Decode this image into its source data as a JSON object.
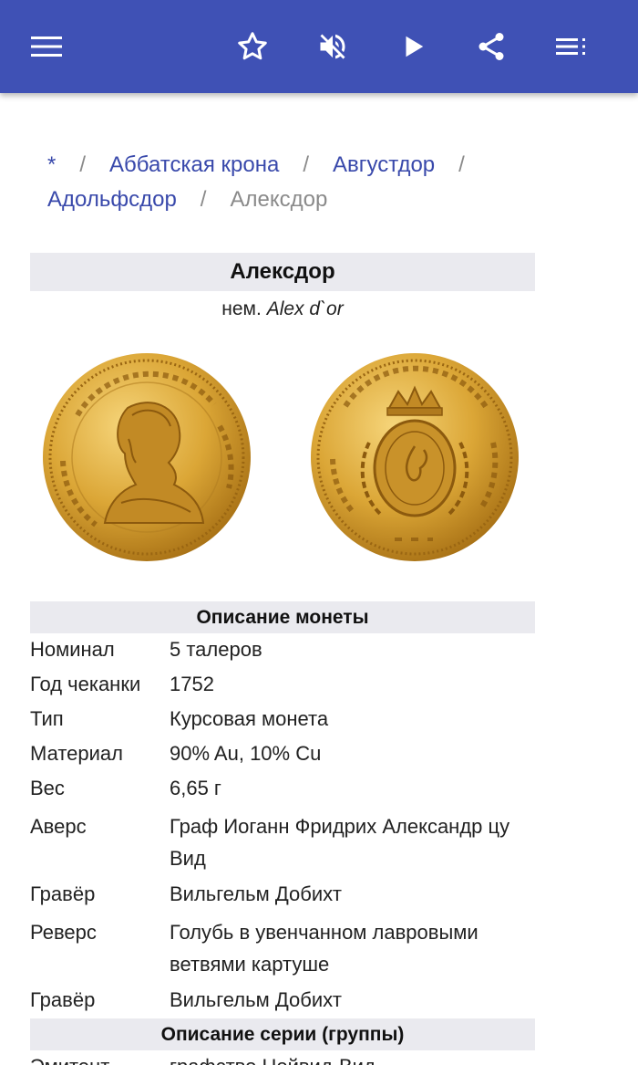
{
  "toolbar": {
    "icons": [
      "menu-icon",
      "star-icon",
      "volume-off-icon",
      "play-icon",
      "share-icon",
      "playlist-icon"
    ]
  },
  "breadcrumb": {
    "items": [
      "*",
      "Аббатская крона",
      "Августдор",
      "Адольфсдор"
    ],
    "separator": "/",
    "current": "Алексдор"
  },
  "infobox": {
    "title": "Алексдор",
    "subtitle_prefix": "нем.",
    "subtitle_name": "Alex d`or",
    "coin_section": "Описание монеты",
    "rows": [
      {
        "label": "Номинал",
        "value": "5 талеров"
      },
      {
        "label": "Год чеканки",
        "value": "1752"
      },
      {
        "label": "Тип",
        "value": "Курсовая монета"
      },
      {
        "label": "Материал",
        "value": "90% Au, 10% Cu"
      },
      {
        "label": "Вес",
        "value": "6,65 г"
      },
      {
        "label": "Аверс",
        "value": "Граф Иоганн Фридрих Александр цу Вид"
      },
      {
        "label": "Гравёр",
        "value": "Вильгельм Добихт"
      },
      {
        "label": "Реверс",
        "value": "Голубь в увенчанном лавровыми ветвями картуше"
      },
      {
        "label": "Гравёр",
        "value": "Вильгельм Добихт"
      }
    ],
    "series_section": "Описание серии (группы)",
    "series_rows": [
      {
        "label": "Эмитент",
        "value": "графство Нойвид-Вид"
      }
    ]
  },
  "colors": {
    "appbar": "#3f51b5",
    "link": "#3949ab",
    "section_bg": "#eaeaef",
    "gold": "#d9a531"
  }
}
